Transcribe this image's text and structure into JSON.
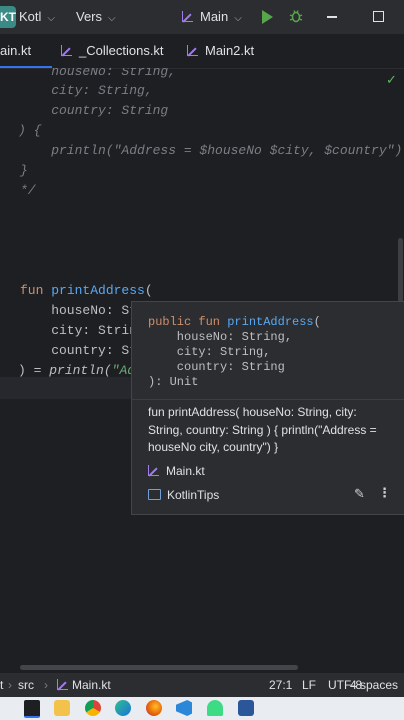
{
  "titlebar": {
    "project_badge": "KT",
    "project_name": "Kotl",
    "vcs_label": "Vers",
    "run_config": "Main"
  },
  "tabs": [
    {
      "label": "ain.kt"
    },
    {
      "label": "_Collections.kt"
    },
    {
      "label": "Main2.kt"
    }
  ],
  "editor": {
    "lines": [
      "    houseNo: String,",
      "    city: String,",
      "    country: String",
      ") {",
      "    println(\"Address = $houseNo $city, $country\")",
      "}",
      "*/"
    ],
    "fun_keyword": "fun",
    "fun_name": "printAddress",
    "fun_open": "(",
    "param1": "    houseNo: St",
    "param2": "    city: Strin",
    "param3": "    country: St",
    "body_prefix": ") = ",
    "body_call": "println(",
    "body_str": "\"Add"
  },
  "doc_popup": {
    "signature": "public fun printAddress(\n    houseNo: String,\n    city: String,\n    country: String\n): Unit",
    "description": "fun printAddress( houseNo: String, city: String, country: String ) { println(\"Address = houseNo city, country\") }",
    "file_link": "Main.kt",
    "module_link": "KotlinTips"
  },
  "statusbar": {
    "path_prefix": "t",
    "path_src": "src",
    "path_file": "Main.kt",
    "position": "27:1",
    "line_sep": "LF",
    "encoding": "UTF-8",
    "indent": "4 spaces"
  },
  "colors": {
    "accent": "#3574f0",
    "kotlin_icon": "#a37bf0",
    "run": "#57a64a"
  }
}
